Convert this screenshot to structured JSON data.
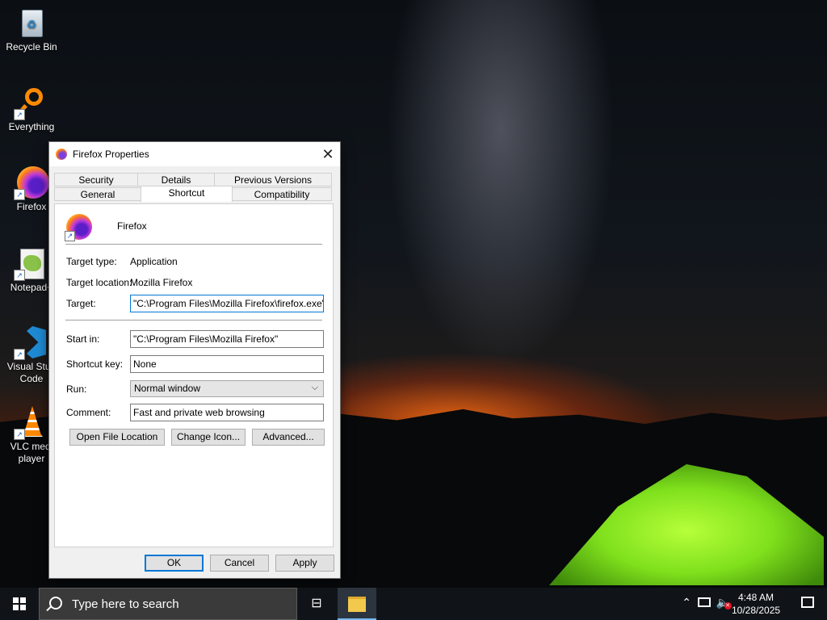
{
  "desktop": {
    "icons": [
      {
        "label": "Recycle Bin"
      },
      {
        "label": "Everything"
      },
      {
        "label": "Firefox"
      },
      {
        "label": "Notepad+"
      },
      {
        "label": "Visual Stud",
        "label2": "Code"
      },
      {
        "label": "VLC medi",
        "label2": "player"
      }
    ]
  },
  "dialog": {
    "title": "Firefox Properties",
    "close_glyph": "✕",
    "tabs_row1": [
      "Security",
      "Details",
      "Previous Versions"
    ],
    "tabs_row2": [
      "General",
      "Shortcut",
      "Compatibility"
    ],
    "active_tab": "Shortcut",
    "app_name": "Firefox",
    "target_type_label": "Target type:",
    "target_type_value": "Application",
    "target_location_label": "Target location:",
    "target_location_value": "Mozilla Firefox",
    "target_label": "Target:",
    "target_value": "\"C:\\Program Files\\Mozilla Firefox\\firefox.exe\"",
    "start_in_label": "Start in:",
    "start_in_value": "\"C:\\Program Files\\Mozilla Firefox\"",
    "shortcut_key_label": "Shortcut key:",
    "shortcut_key_value": "None",
    "run_label": "Run:",
    "run_value": "Normal window",
    "comment_label": "Comment:",
    "comment_value": "Fast and private web browsing",
    "open_file_location": "Open File Location",
    "change_icon": "Change Icon...",
    "advanced": "Advanced...",
    "ok": "OK",
    "cancel": "Cancel",
    "apply": "Apply"
  },
  "taskbar": {
    "search_placeholder": "Type here to search",
    "time": "4:48 AM",
    "date": "10/28/2025"
  }
}
